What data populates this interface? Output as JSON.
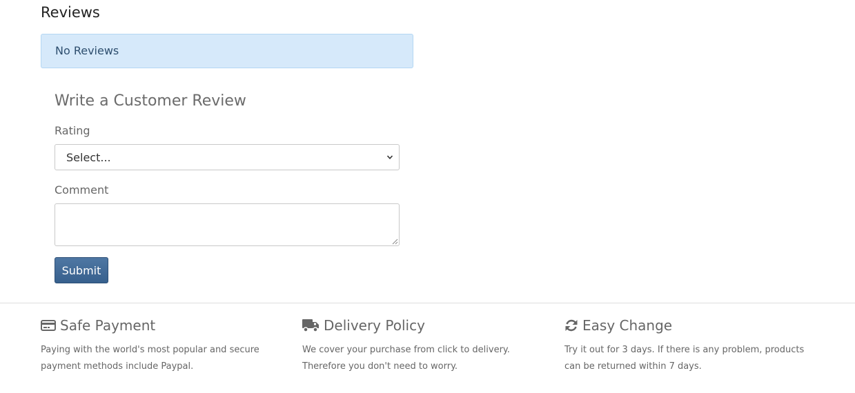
{
  "reviews": {
    "heading": "Reviews",
    "empty_message": "No Reviews"
  },
  "form": {
    "title": "Write a Customer Review",
    "rating_label": "Rating",
    "rating_selected": "Select...",
    "comment_label": "Comment",
    "comment_value": "",
    "submit_label": "Submit"
  },
  "features": [
    {
      "icon": "credit-card-icon",
      "title": "Safe Payment",
      "text": "Paying with the world's most popular and secure payment methods include Paypal."
    },
    {
      "icon": "truck-icon",
      "title": "Delivery Policy",
      "text": "We cover your purchase from click to delivery. Therefore you don't need to worry."
    },
    {
      "icon": "refresh-icon",
      "title": "Easy Change",
      "text": "Try it out for 3 days. If there is any problem, products can be returned within 7 days."
    }
  ],
  "colors": {
    "alert_background": "#d6e9fa",
    "alert_text": "#2d4e6e",
    "button_primary": "#3f6894",
    "muted_text": "#666666"
  }
}
